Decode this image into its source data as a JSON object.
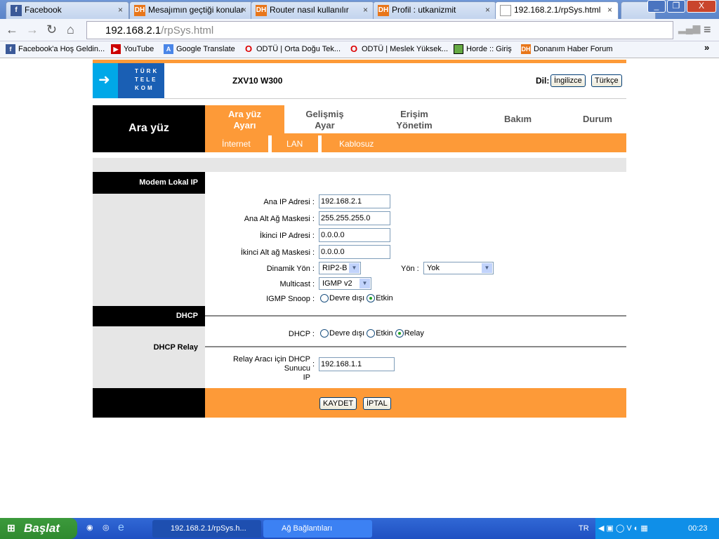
{
  "browser": {
    "tabs": [
      {
        "label": "Facebook",
        "icon": "facebook-icon"
      },
      {
        "label": "Mesajımın geçtiği konular",
        "icon": "dh-icon"
      },
      {
        "label": "Router nasıl kullanılır",
        "icon": "dh-icon"
      },
      {
        "label": "Profil : utkanizmit",
        "icon": "dh-icon"
      },
      {
        "label": "192.168.2.1/rpSys.html",
        "icon": "page-icon",
        "active": true
      }
    ],
    "url_host": "192.168.2.1",
    "url_path": "/rpSys.html",
    "bookmarks": [
      {
        "label": "Facebook'a Hoş Geldin...",
        "icon": "facebook-icon"
      },
      {
        "label": "YouTube",
        "icon": "youtube-icon"
      },
      {
        "label": "Google Translate",
        "icon": "translate-icon"
      },
      {
        "label": "ODTÜ | Orta Doğu Tek...",
        "icon": "opera-icon"
      },
      {
        "label": "ODTÜ | Meslek Yüksek...",
        "icon": "opera-icon"
      },
      {
        "label": "Horde :: Giriş",
        "icon": "horde-icon"
      },
      {
        "label": "Donanım Haber Forum",
        "icon": "dh-icon"
      }
    ]
  },
  "header": {
    "logo_lines": [
      "TÜRK",
      "TELE",
      "KOM"
    ],
    "model": "ZXV10 W300",
    "lang_label": "Dil:",
    "lang_en": "İngilizce",
    "lang_tr": "Türkçe"
  },
  "nav": {
    "section": "Ara yüz",
    "tabs": [
      {
        "l1": "Ara yüz",
        "l2": "Ayarı",
        "active": true
      },
      {
        "l1": "Gelişmiş",
        "l2": "Ayar"
      },
      {
        "l1": "Erişim",
        "l2": "Yönetim"
      },
      {
        "l1": "Bakım",
        "l2": ""
      },
      {
        "l1": "Durum",
        "l2": ""
      }
    ],
    "subtabs": [
      "İnternet",
      "LAN",
      "Kablosuz"
    ]
  },
  "lan": {
    "section_title": "Modem Lokal IP",
    "ip_label": "Ana IP Adresi :",
    "ip": "192.168.2.1",
    "mask_label": "Ana Alt Ağ Maskesi :",
    "mask": "255.255.255.0",
    "ip2_label": "İkinci IP Adresi :",
    "ip2": "0.0.0.0",
    "mask2_label": "İkinci Alt ağ Maskesi :",
    "mask2": "0.0.0.0",
    "dyn_label": "Dinamik Yön :",
    "dyn": "RIP2-B",
    "dir_label": "Yön :",
    "dir": "Yok",
    "mc_label": "Multicast :",
    "mc": "IGMP v2",
    "snoop_label": "IGMP Snoop :",
    "snoop_off": "Devre dışı",
    "snoop_on": "Etkin",
    "snoop_value": "Etkin"
  },
  "dhcp": {
    "section_title": "DHCP",
    "relay_title": "DHCP Relay",
    "dhcp_label": "DHCP :",
    "opt_off": "Devre dışı",
    "opt_on": "Etkin",
    "opt_relay": "Relay",
    "value": "Relay",
    "relay_label_1": "Relay Aracı için DHCP Sunucu",
    "relay_label_2": "IP",
    "relay_ip": "192.168.1.1"
  },
  "footer": {
    "save": "KAYDET",
    "cancel": "İPTAL"
  },
  "colors": {
    "orange": "#fd9a38",
    "logo_blue": "#1a5fb4"
  },
  "taskbar": {
    "start": "Başlat",
    "tasks": [
      "192.168.2.1/rpSys.h...",
      "Ağ Bağlantıları"
    ],
    "lang": "TR",
    "clock": "00:23"
  }
}
